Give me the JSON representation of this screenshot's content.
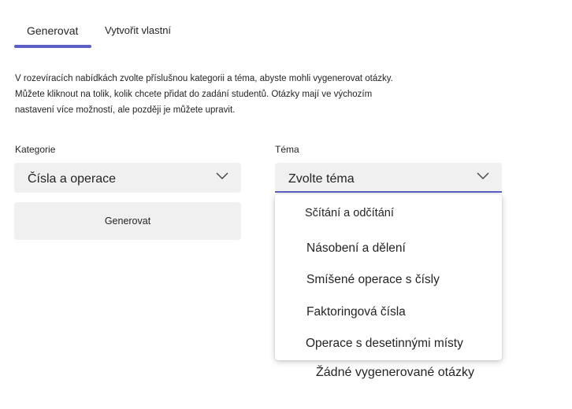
{
  "tabs": [
    {
      "label": "Generovat",
      "selected": true
    },
    {
      "label": "Vytvořit vlastní",
      "selected": false
    }
  ],
  "description": {
    "line1": "V rozevíracích nabídkách zvolte příslušnou kategorii a téma, abyste mohli vygenerovat otázky.",
    "line2": "Můžete kliknout na tolik, kolik chcete přidat do zadání studentů. Otázky mají ve výchozím",
    "line3": "nastavení více možností, ale později je můžete upravit."
  },
  "category": {
    "label": "Kategorie",
    "value": "Čísla a operace",
    "icon": "chevron-down-icon"
  },
  "topic": {
    "label": "Téma",
    "placeholder": "Zvolte téma",
    "icon": "chevron-down-icon",
    "options": [
      "Sčítání a odčítání",
      "Násobení a dělení",
      "Smíšené operace s čísly",
      "Faktoringová čísla",
      "Operace s desetinnými místy"
    ]
  },
  "generate_button": {
    "label": "Generovat"
  },
  "empty_state": "Žádné vygenerované otázky",
  "colors": {
    "accent": "#5b5fc7",
    "field_background": "#f0f0f0",
    "text": "#242424"
  }
}
